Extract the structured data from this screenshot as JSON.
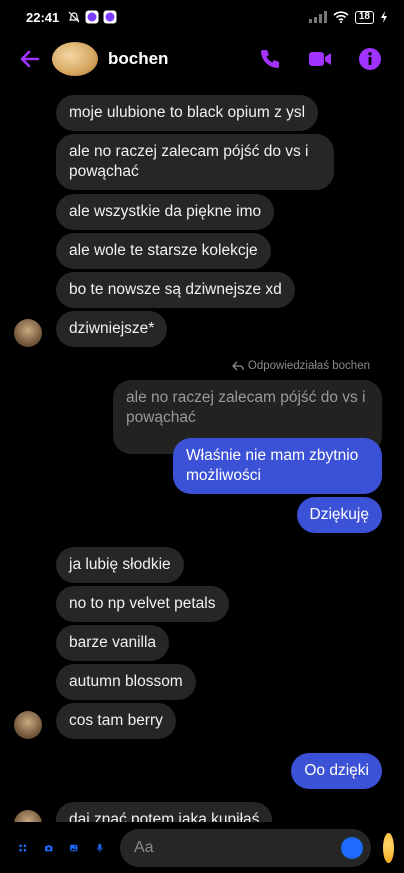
{
  "status": {
    "time": "22:41",
    "battery": "18"
  },
  "header": {
    "contact_name": "bochen"
  },
  "reply_note": "Odpowiedziałaś bochen",
  "messages": {
    "m1": "moje ulubione to black opium z ysl",
    "m2": "ale no raczej zalecam pójść do vs i powąchać",
    "m3": "ale wszystkie da piękne imo",
    "m4": "ale wole te starsze kolekcje",
    "m5": "bo te nowsze są dziwnejsze xd",
    "m6": "dziwniejsze*",
    "quoted": "ale no raczej zalecam pójść do vs i powąchać",
    "o1": "Właśnie nie mam zbytnio możliwości",
    "o2": "Dziękuję",
    "m7": "ja lubię słodkie",
    "m8": "no to np velvet petals",
    "m9": "barze vanilla",
    "m10": "autumn blossom",
    "m11": "cos tam berry",
    "o3": "Oo dzięki",
    "m12": "daj znać potem jaka kupiłaś"
  },
  "composer": {
    "placeholder": "Aa"
  },
  "colors": {
    "accent": "#a033ff",
    "outgoing": "#3b51d6",
    "incoming": "#262626",
    "toolbar": "#1d6bff"
  }
}
